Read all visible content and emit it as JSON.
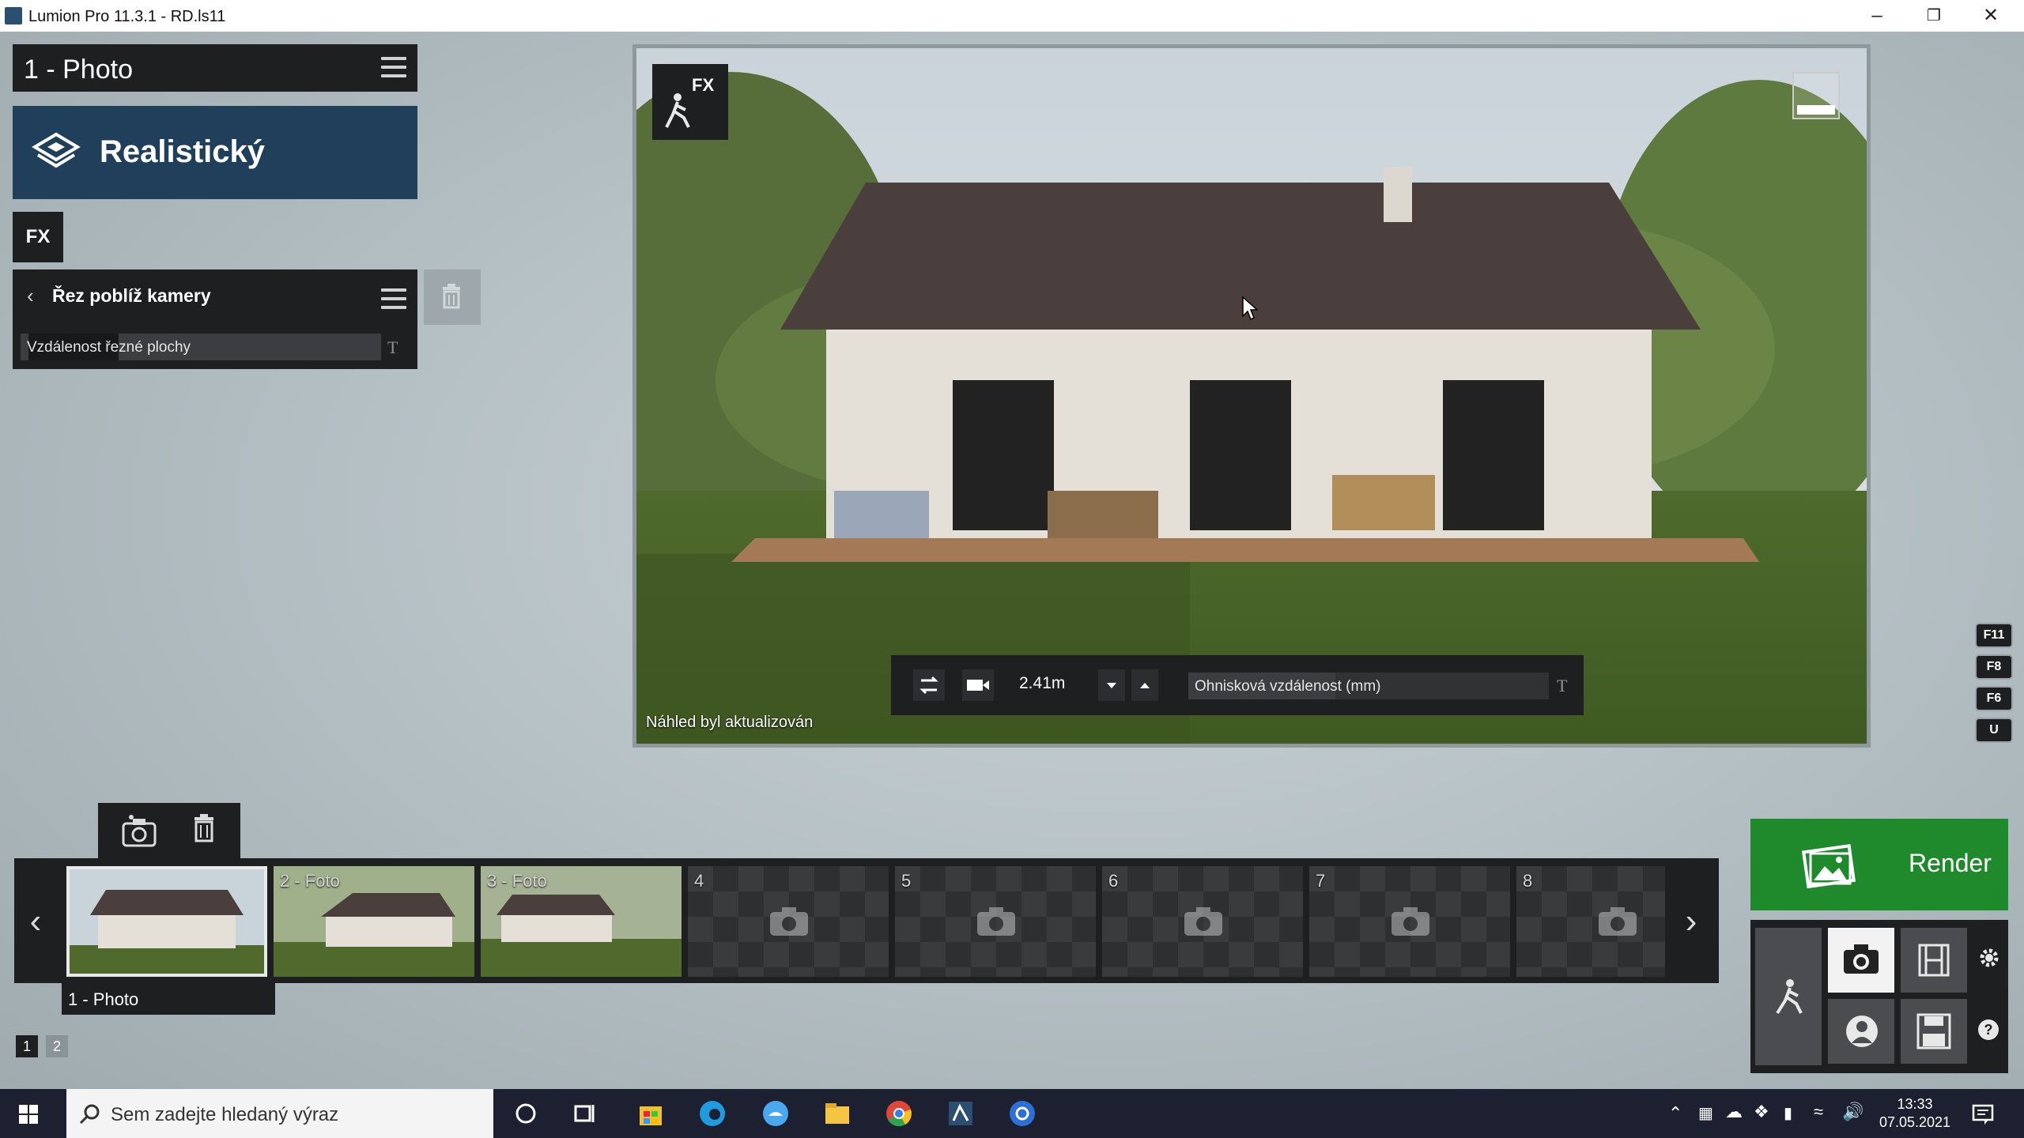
{
  "window": {
    "title": "Lumion Pro 11.3.1 - RD.ls11"
  },
  "left_panel": {
    "photo_header": "1 - Photo",
    "style_label": "Realistický",
    "fx_label": "FX",
    "effect": {
      "title": "Řez poblíž kamery",
      "slider_label": "Vzdálenost řezné plochy",
      "slider_value": 0,
      "text_icon": "T"
    }
  },
  "viewport": {
    "fx_label": "FX",
    "status": "Náhled byl aktualizován",
    "camera_height": "2.41m",
    "focal_label": "Ohnisková vzdálenost (mm)",
    "focal_value": 0.29,
    "text_icon": "T"
  },
  "side_keys": [
    "F11",
    "F8",
    "F6",
    "U"
  ],
  "strip": {
    "slots": [
      {
        "label": "",
        "filled": true,
        "selected": true
      },
      {
        "label": "2 - Foto",
        "filled": true,
        "selected": false
      },
      {
        "label": "3 - Foto",
        "filled": true,
        "selected": false
      },
      {
        "label": "4",
        "filled": false
      },
      {
        "label": "5",
        "filled": false
      },
      {
        "label": "6",
        "filled": false
      },
      {
        "label": "7",
        "filled": false
      },
      {
        "label": "8",
        "filled": false
      }
    ],
    "selected_label": "1 - Photo",
    "pages": [
      "1",
      "2"
    ]
  },
  "render": {
    "label": "Render"
  },
  "taskbar": {
    "search_placeholder": "Sem zadejte hledaný výraz",
    "time": "13:33",
    "date": "07.05.2021"
  },
  "colors": {
    "render_green": "#1f8a2c",
    "style_blue": "#1f3f5a",
    "panel_dark": "#1e1f21"
  }
}
